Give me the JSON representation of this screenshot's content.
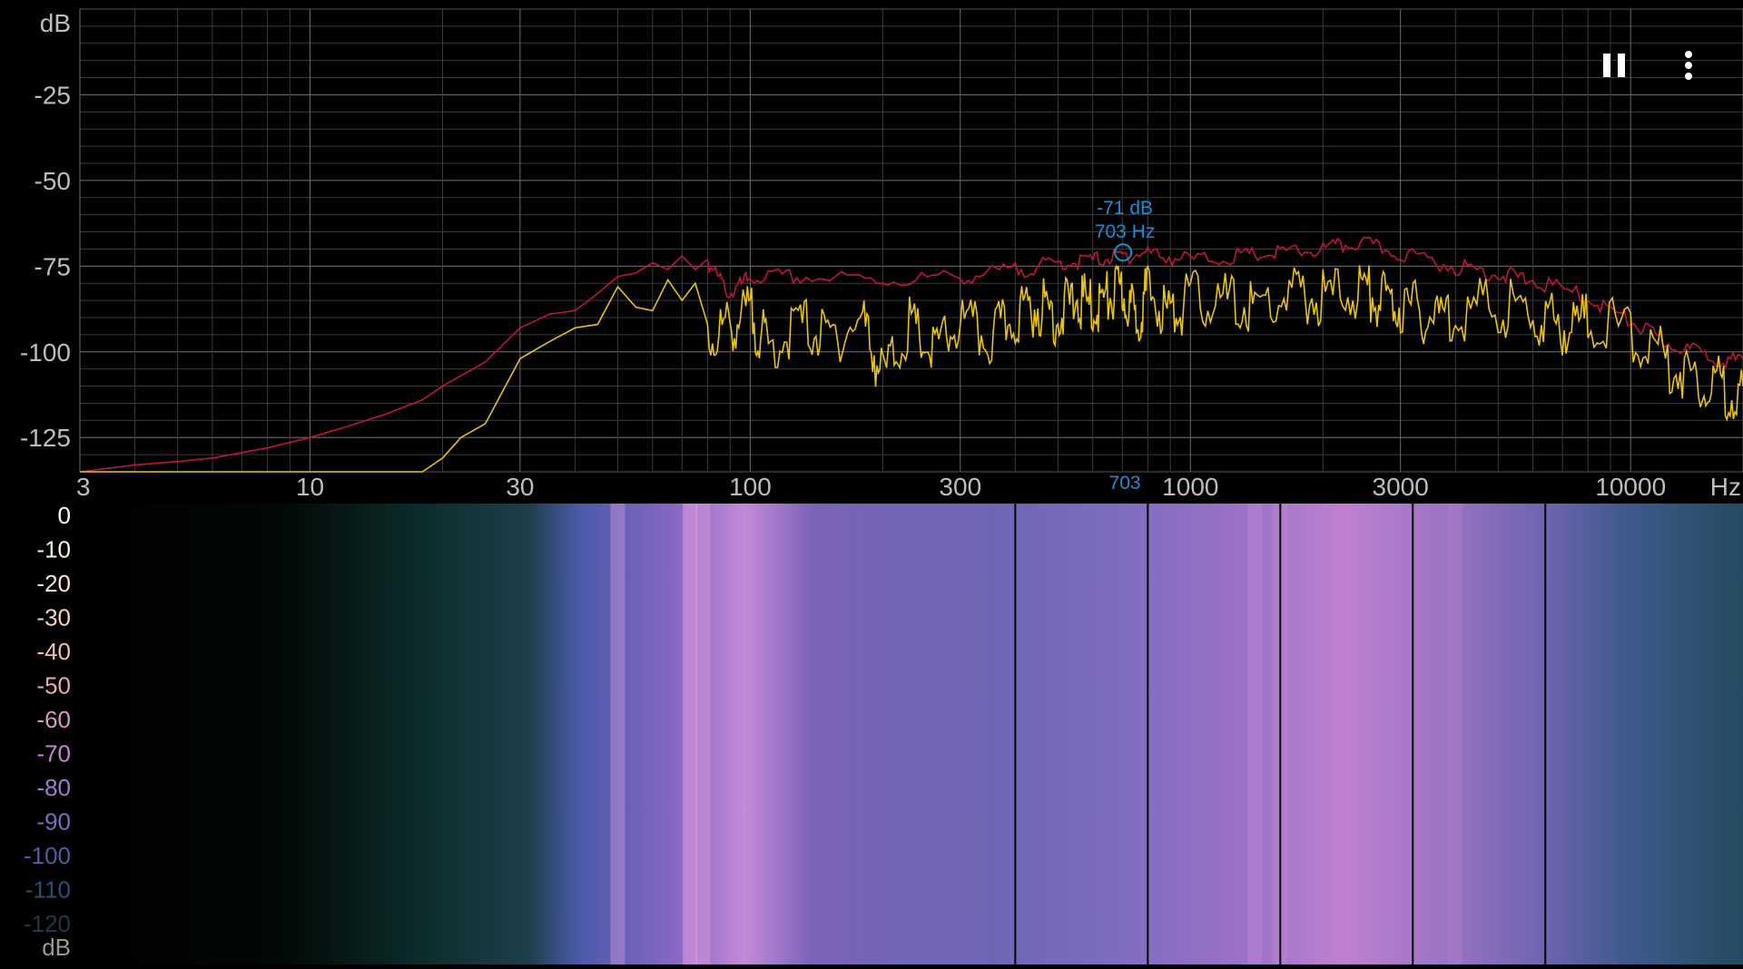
{
  "toolbar": {
    "pause_icon": "pause-icon",
    "menu_icon": "more-vert-icon"
  },
  "colors": {
    "background": "#000000",
    "grid": "#3a3a3a",
    "grid_major": "#6a6a6a",
    "axis_text": "#bdbdbd",
    "peak_hold": "#c0163c",
    "spectrum": "#e8c21a",
    "cursor": "#1a8fd6"
  },
  "cursor": {
    "db_label": "-71 dB",
    "hz_label": "703 Hz",
    "freq_label": "703",
    "freq": 703,
    "db": -71
  },
  "spectrogram": {
    "db_unit": "dB",
    "colorbar_ticks": [
      "0",
      "-10",
      "-20",
      "-30",
      "-40",
      "-50",
      "-60",
      "-70",
      "-80",
      "-90",
      "-100",
      "-110",
      "-120"
    ],
    "colorbar_colors": [
      "#ffffff",
      "#fff6d8",
      "#fbe6c4",
      "#f6d3b8",
      "#f0c0b0",
      "#e8a8b8",
      "#d895c8",
      "#c884d0",
      "#a678c8",
      "#7c6cbc",
      "#4e5ea4",
      "#2c4c78",
      "#1c3a48"
    ]
  },
  "chart_data": {
    "type": "line",
    "title": "",
    "xlabel": "Hz",
    "ylabel": "dB",
    "xscale": "log",
    "xlim": [
      3,
      18000
    ],
    "ylim": [
      -135,
      0
    ],
    "x_tick_labels": [
      "3",
      "10",
      "30",
      "100",
      "300",
      "1000",
      "3000",
      "10000",
      "Hz"
    ],
    "y_tick_labels": [
      "dB",
      "-25",
      "-50",
      "-75",
      "-100",
      "-125"
    ],
    "grid": true,
    "series": [
      {
        "color": "#c0163c",
        "x": [
          3,
          4,
          5,
          6,
          8,
          10,
          12,
          15,
          18,
          20,
          25,
          30,
          35,
          40,
          45,
          50,
          55,
          60,
          65,
          70,
          75,
          80,
          90,
          100,
          130,
          200,
          300,
          400,
          500,
          600,
          700,
          800,
          1000,
          1300,
          1600,
          2000,
          2400,
          3000,
          4000,
          5000,
          6000,
          8000,
          10000,
          12000,
          15000,
          18000
        ],
        "y": [
          -135,
          -133,
          -132,
          -131,
          -128,
          -125,
          -122,
          -118,
          -114,
          -110,
          -103,
          -93,
          -89,
          -88,
          -83,
          -78,
          -77,
          -74,
          -76,
          -72,
          -76,
          -73,
          -82,
          -77,
          -77,
          -78,
          -77,
          -75,
          -73,
          -72,
          -71,
          -70,
          -72,
          -71,
          -70,
          -69,
          -67,
          -70,
          -74,
          -76,
          -78,
          -83,
          -90,
          -96,
          -100,
          -102
        ]
      },
      {
        "color": "#e8c21a",
        "x": [
          3,
          5,
          8,
          12,
          18,
          20,
          22,
          25,
          30,
          35,
          40,
          45,
          50,
          55,
          60,
          65,
          70,
          75,
          80,
          90,
          100,
          110,
          130,
          150,
          180,
          200,
          230,
          260,
          300,
          350,
          400,
          450,
          500,
          550,
          600,
          650,
          700,
          750,
          800,
          900,
          1000,
          1200,
          1400,
          1700,
          2000,
          2400,
          2700,
          3000,
          3500,
          4000,
          5000,
          6000,
          7000,
          8000,
          10000,
          12000,
          14000,
          16000,
          18000
        ],
        "y": [
          -135,
          -135,
          -135,
          -135,
          -135,
          -131,
          -125,
          -121,
          -102,
          -97,
          -93,
          -92,
          -81,
          -87,
          -88,
          -79,
          -85,
          -80,
          -92,
          -88,
          -84,
          -95,
          -87,
          -92,
          -86,
          -103,
          -88,
          -96,
          -87,
          -92,
          -85,
          -82,
          -85,
          -80,
          -83,
          -80,
          -78,
          -86,
          -78,
          -85,
          -80,
          -81,
          -83,
          -79,
          -80,
          -77,
          -80,
          -82,
          -85,
          -84,
          -82,
          -85,
          -88,
          -86,
          -90,
          -98,
          -103,
          -105,
          -110
        ]
      }
    ]
  }
}
